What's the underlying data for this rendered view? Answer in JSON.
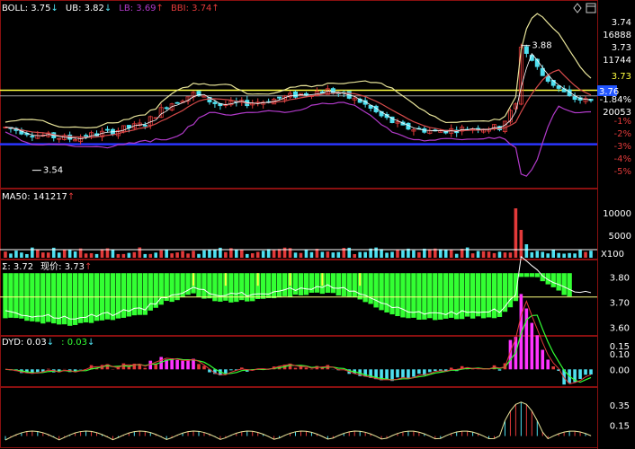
{
  "colors": {
    "bg": "#000000",
    "panel_border": "#8a1010",
    "up": "#e23a3a",
    "down": "#4fe0f0",
    "upper_band": "#e8e49a",
    "mid_band": "#d64a4a",
    "lower_band": "#b13ac9",
    "white_line": "#ffffff",
    "yellow_line": "#ffff40",
    "blue_line": "#2a35ff",
    "grey_line": "#a0a0a0",
    "green_fill": "#33ff33",
    "magenta": "#ff33ff",
    "axis_text": "#ffffff"
  },
  "panel1": {
    "legend": [
      {
        "text": "BOLL: 3.75",
        "arrow": "↓",
        "color": "#ffffff",
        "arrow_color": "#4fe0f0"
      },
      {
        "text": "UB: 3.82",
        "arrow": "↓",
        "color": "#ffffff",
        "arrow_color": "#4fe0f0"
      },
      {
        "text": "LB: 3.69",
        "arrow": "↑",
        "color": "#b13ac9",
        "arrow_color": "#e23a3a"
      },
      {
        "text": "BBI: 3.74",
        "arrow": "↑",
        "color": "#e23a3a",
        "arrow_color": "#e23a3a"
      }
    ],
    "right_ticks": [
      {
        "text": "3.74",
        "color": "#ffffff"
      },
      {
        "text": "16888",
        "color": "#ffffff"
      },
      {
        "text": "3.73",
        "color": "#ffffff"
      },
      {
        "text": "11744",
        "color": "#ffffff"
      },
      {
        "text": "3.73",
        "color": "#ffff40"
      },
      {
        "text": "-1.84%",
        "color": "#ffffff"
      },
      {
        "text": "20053",
        "color": "#ffffff"
      },
      {
        "text": "-1%",
        "color": "#e23a3a"
      },
      {
        "text": "-2%",
        "color": "#e23a3a"
      },
      {
        "text": "-3%",
        "color": "#e23a3a"
      },
      {
        "text": "-4%",
        "color": "#e23a3a"
      },
      {
        "text": "-5%",
        "color": "#e23a3a"
      }
    ],
    "price_tag": "3.76",
    "high_label": "3.88",
    "low_label": "3.54",
    "icons": [
      "diamond-icon",
      "window-icon"
    ]
  },
  "panel2": {
    "legend": [
      {
        "text": "MA50: 141217",
        "arrow": "↑",
        "color": "#ffffff",
        "arrow_color": "#e23a3a"
      }
    ],
    "ticks": [
      "10000",
      "5000"
    ],
    "unit": "X100"
  },
  "panel3": {
    "legend": [
      {
        "text": "Σ: 3.72",
        "arrow": "",
        "color": "#ffffff",
        "arrow_color": "#ffffff"
      },
      {
        "text": "现价: 3.73",
        "arrow": "↑",
        "color": "#ffffff",
        "arrow_color": "#e23a3a"
      }
    ],
    "ticks": [
      "3.80",
      "3.70",
      "3.60"
    ]
  },
  "panel4": {
    "legend": [
      {
        "text": "DYD: 0.03",
        "arrow": "↓",
        "color": "#ffffff",
        "arrow_color": "#4fe0f0"
      },
      {
        "text": ": 0.03",
        "arrow": "↓",
        "color": "#33ff33",
        "arrow_color": "#4fe0f0"
      }
    ],
    "ticks": [
      "0.15",
      "0.10",
      "0.00"
    ]
  },
  "panel5": {
    "ticks": [
      "0.35",
      "0.15"
    ]
  },
  "chart_data": {
    "type": "line",
    "title": "",
    "bar_count": 110,
    "price_path": [
      [
        0,
        3.66
      ],
      [
        6,
        3.64
      ],
      [
        12,
        3.63
      ],
      [
        20,
        3.65
      ],
      [
        26,
        3.67
      ],
      [
        30,
        3.72
      ],
      [
        35,
        3.75
      ],
      [
        40,
        3.72
      ],
      [
        48,
        3.73
      ],
      [
        55,
        3.75
      ],
      [
        60,
        3.76
      ],
      [
        66,
        3.73
      ],
      [
        70,
        3.69
      ],
      [
        74,
        3.66
      ],
      [
        80,
        3.65
      ],
      [
        88,
        3.66
      ],
      [
        92,
        3.66
      ],
      [
        95,
        3.72
      ],
      [
        96,
        3.88
      ],
      [
        100,
        3.8
      ],
      [
        105,
        3.74
      ],
      [
        109,
        3.73
      ]
    ],
    "reference_lines": {
      "yellow": 3.76,
      "blue": 3.615,
      "grey": 3.745
    },
    "volume_ticks": [
      10000,
      5000
    ],
    "sigma_range": [
      3.58,
      3.83
    ],
    "dyd_range": [
      -0.05,
      0.18
    ],
    "osc_range": [
      0.0,
      0.45
    ]
  }
}
